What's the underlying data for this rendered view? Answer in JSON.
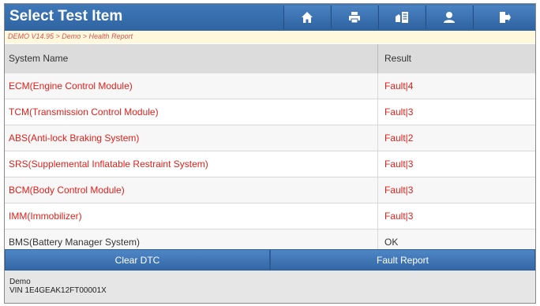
{
  "header": {
    "title": "Select Test Item",
    "buttons": [
      {
        "icon": "home-icon"
      },
      {
        "icon": "print-icon"
      },
      {
        "icon": "report-icon"
      },
      {
        "icon": "user-icon"
      },
      {
        "icon": "exit-icon"
      }
    ]
  },
  "breadcrumb": "DEMO V14.95 > Demo > Health Report",
  "table": {
    "columns": [
      "System Name",
      "Result"
    ],
    "rows": [
      {
        "name": "ECM(Engine Control Module)",
        "result": "Fault|4",
        "status": "fault"
      },
      {
        "name": "TCM(Transmission Control Module)",
        "result": "Fault|3",
        "status": "fault"
      },
      {
        "name": "ABS(Anti-lock Braking System)",
        "result": "Fault|2",
        "status": "fault"
      },
      {
        "name": "SRS(Supplemental Inflatable Restraint System)",
        "result": "Fault|3",
        "status": "fault"
      },
      {
        "name": "BCM(Body Control Module)",
        "result": "Fault|3",
        "status": "fault"
      },
      {
        "name": "IMM(Immobilizer)",
        "result": "Fault|3",
        "status": "fault"
      },
      {
        "name": "BMS(Battery Manager System)",
        "result": "OK",
        "status": "ok"
      }
    ]
  },
  "actions": {
    "clear_dtc": "Clear DTC",
    "fault_report": "Fault Report"
  },
  "footer": {
    "line1": "Demo",
    "line2": "VIN 1E4GEAK12FT00001X"
  },
  "colors": {
    "fault": "#e0201b",
    "ok": "#333333",
    "accent": "#3467a6"
  }
}
